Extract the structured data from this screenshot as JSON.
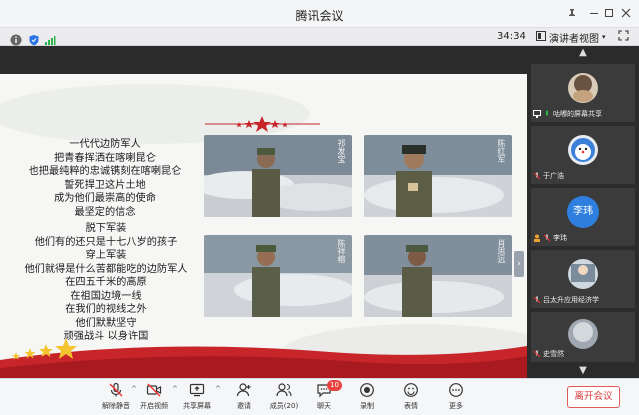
{
  "window": {
    "title": "腾讯会议"
  },
  "infobar": {
    "timer": "34:34",
    "view_label": "演讲者视图"
  },
  "slide": {
    "poem_block_1": [
      "一代代边防军人",
      "把青春挥洒在喀喇昆仑",
      "也把最纯粹的忠诚镌刻在喀喇昆仑",
      "誓死捍卫这片土地",
      "成为他们最崇高的使命",
      "最坚定的信念"
    ],
    "poem_block_2": [
      "脱下军装",
      "他们有的还只是十七八岁的孩子",
      "穿上军装",
      "他们就得是什么苦都能吃的边防军人",
      "在四五千米的高原",
      "在祖国边境一线",
      "在我们的视线之外",
      "他们默默坚守",
      "顽强战斗 以身许国"
    ],
    "photo_captions": [
      "祁发宝",
      "陈红军",
      "陈祥榕",
      "肖思远"
    ]
  },
  "participants": [
    {
      "name": "咕嘟的屏幕共享",
      "avatar_type": "photo"
    },
    {
      "name": "于广浩",
      "avatar_type": "cartoon"
    },
    {
      "name": "李玮",
      "avatar_text": "李玮",
      "avatar_color": "#2f7fe0"
    },
    {
      "name": "吕太升应用经济学",
      "avatar_type": "photo"
    },
    {
      "name": "史雪然",
      "avatar_type": "photo"
    }
  ],
  "toolbar": {
    "mute": "解除静音",
    "video": "开启视频",
    "share": "共享屏幕",
    "invite": "邀请",
    "members": "成员(20)",
    "chat": "聊天",
    "chat_badge": "10",
    "record": "录制",
    "emoji": "表情",
    "more": "更多",
    "leave": "离开会议"
  },
  "colors": {
    "accent": "#1d66d6",
    "leave_red": "#d93a3a",
    "ribbon_red": "#c8252b",
    "badge_red": "#e8423f"
  }
}
